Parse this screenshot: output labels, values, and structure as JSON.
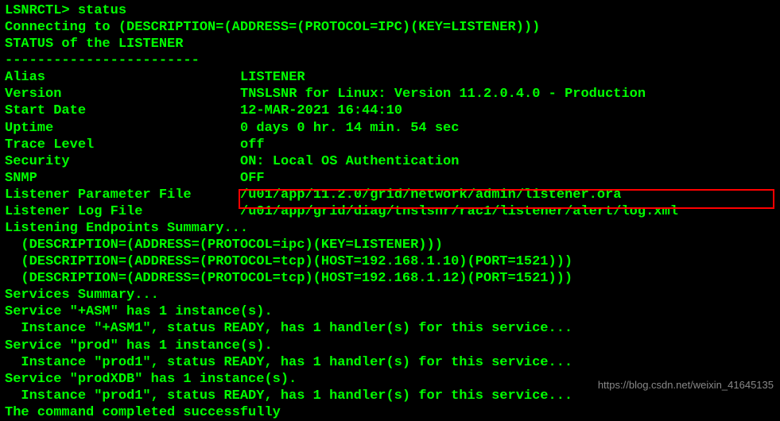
{
  "prompt": "LSNRCTL> ",
  "command": "status",
  "connecting": "Connecting to (DESCRIPTION=(ADDRESS=(PROTOCOL=IPC)(KEY=LISTENER)))",
  "status_header": "STATUS of the LISTENER",
  "separator": "------------------------",
  "kv": {
    "alias": {
      "label": "Alias",
      "value": "LISTENER"
    },
    "version": {
      "label": "Version",
      "value": "TNSLSNR for Linux: Version 11.2.0.4.0 - Production"
    },
    "start_date": {
      "label": "Start Date",
      "value": "12-MAR-2021 16:44:10"
    },
    "uptime": {
      "label": "Uptime",
      "value": "0 days 0 hr. 14 min. 54 sec"
    },
    "trace_level": {
      "label": "Trace Level",
      "value": "off"
    },
    "security": {
      "label": "Security",
      "value": "ON: Local OS Authentication"
    },
    "snmp": {
      "label": "SNMP",
      "value": "OFF"
    },
    "param_file": {
      "label": "Listener Parameter File",
      "value": "/u01/app/11.2.0/grid/network/admin/listener.ora"
    },
    "log_file": {
      "label": "Listener Log File",
      "value": "/u01/app/grid/diag/tnslsnr/rac1/listener/alert/log.xml"
    }
  },
  "endpoints_header": "Listening Endpoints Summary...",
  "endpoints": [
    "  (DESCRIPTION=(ADDRESS=(PROTOCOL=ipc)(KEY=LISTENER)))",
    "  (DESCRIPTION=(ADDRESS=(PROTOCOL=tcp)(HOST=192.168.1.10)(PORT=1521)))",
    "  (DESCRIPTION=(ADDRESS=(PROTOCOL=tcp)(HOST=192.168.1.12)(PORT=1521)))"
  ],
  "services_header": "Services Summary...",
  "services": [
    "Service \"+ASM\" has 1 instance(s).",
    "  Instance \"+ASM1\", status READY, has 1 handler(s) for this service...",
    "Service \"prod\" has 1 instance(s).",
    "  Instance \"prod1\", status READY, has 1 handler(s) for this service...",
    "Service \"prodXDB\" has 1 instance(s).",
    "  Instance \"prod1\", status READY, has 1 handler(s) for this service..."
  ],
  "completed": "The command completed successfully",
  "watermark": "https://blog.csdn.net/weixin_41645135"
}
